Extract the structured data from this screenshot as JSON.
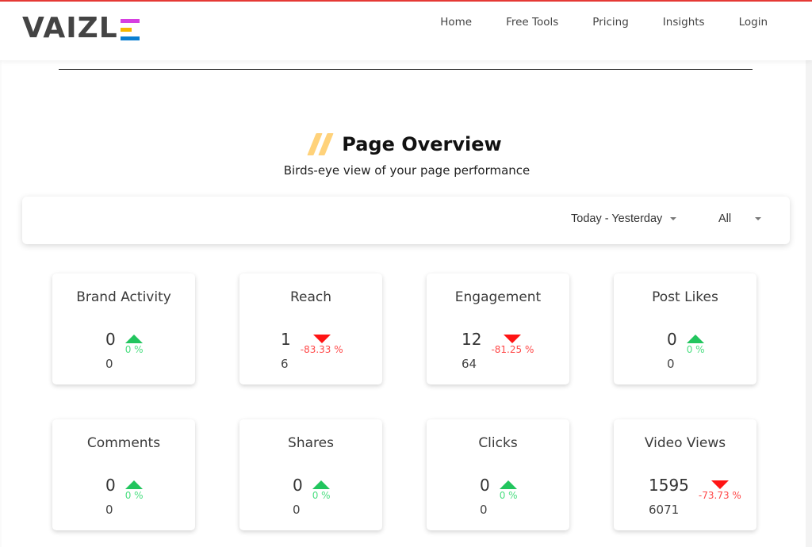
{
  "brand": {
    "name": "VAIZL",
    "colors": {
      "accent_top": "#e53935",
      "e_bar_1": "#d63fe0",
      "e_bar_2": "#f5b800",
      "e_bar_3": "#0a7fd1"
    }
  },
  "nav": {
    "items": [
      {
        "label": "Home"
      },
      {
        "label": "Free Tools"
      },
      {
        "label": "Pricing"
      },
      {
        "label": "Insights"
      },
      {
        "label": "Login"
      }
    ]
  },
  "header": {
    "title": "Page Overview",
    "subtitle": "Birds-eye view of your page performance",
    "decor_icon": "double-slash-icon"
  },
  "filters": {
    "date_range": {
      "selected": "Today - Yesterday",
      "icon": "caret-down-icon"
    },
    "scope": {
      "selected": "All",
      "icon": "caret-down-icon"
    }
  },
  "colors": {
    "up": "#22c55e",
    "up_text": "#4ade80",
    "down": "#ff1414",
    "down_text": "#ff4848"
  },
  "metrics": [
    {
      "title": "Brand Activity",
      "current": "0",
      "previous": "0",
      "change": "0 %",
      "trend": "up"
    },
    {
      "title": "Reach",
      "current": "1",
      "previous": "6",
      "change": "-83.33 %",
      "trend": "down"
    },
    {
      "title": "Engagement",
      "current": "12",
      "previous": "64",
      "change": "-81.25 %",
      "trend": "down"
    },
    {
      "title": "Post Likes",
      "current": "0",
      "previous": "0",
      "change": "0 %",
      "trend": "up"
    },
    {
      "title": "Comments",
      "current": "0",
      "previous": "0",
      "change": "0 %",
      "trend": "up"
    },
    {
      "title": "Shares",
      "current": "0",
      "previous": "0",
      "change": "0 %",
      "trend": "up"
    },
    {
      "title": "Clicks",
      "current": "0",
      "previous": "0",
      "change": "0 %",
      "trend": "up"
    },
    {
      "title": "Video Views",
      "current": "1595",
      "previous": "6071",
      "change": "-73.73 %",
      "trend": "down"
    }
  ]
}
